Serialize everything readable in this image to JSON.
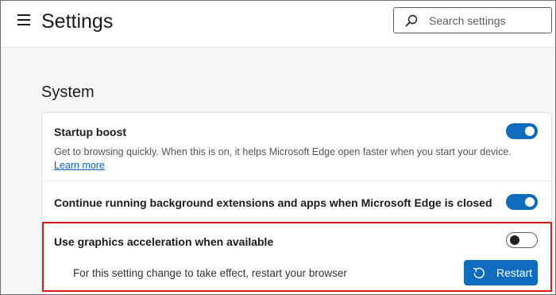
{
  "header": {
    "title": "Settings",
    "menu_icon": "hamburger-menu-icon",
    "search": {
      "placeholder": "Search settings",
      "value": "",
      "icon": "search-icon"
    }
  },
  "section": {
    "title": "System",
    "settings": [
      {
        "title": "Startup boost",
        "description": "Get to browsing quickly. When this is on, it helps Microsoft Edge open faster when you start your device.",
        "link_text": "Learn more",
        "enabled": true
      },
      {
        "title": "Continue running background extensions and apps when Microsoft Edge is closed",
        "enabled": true
      },
      {
        "title": "Use graphics acceleration when available",
        "enabled": false,
        "restart_notice": "For this setting change to take effect, restart your browser",
        "restart_button": {
          "label": "Restart",
          "icon": "restart-icon"
        }
      }
    ]
  },
  "colors": {
    "accent": "#0f6cbd",
    "highlight_border": "#e01a1a",
    "link": "#0a5fb0"
  }
}
